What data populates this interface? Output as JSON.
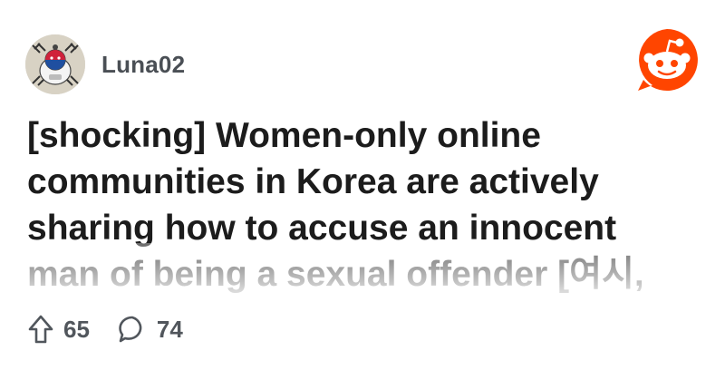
{
  "post": {
    "author": "Luna02",
    "title": "[shocking] Women-only online communities in Korea are actively sharing how to accuse an innocent man of being a sexual offender [여시,",
    "upvotes": "65",
    "comments": "74"
  },
  "icons": {
    "avatar": "avatar-image",
    "logo": "reddit-logo-icon",
    "upvote": "upvote-arrow-icon",
    "comment": "comment-bubble-icon"
  },
  "colors": {
    "brand": "#ff4500",
    "title_text": "#1c1c1c",
    "meta_text": "#51565c"
  }
}
